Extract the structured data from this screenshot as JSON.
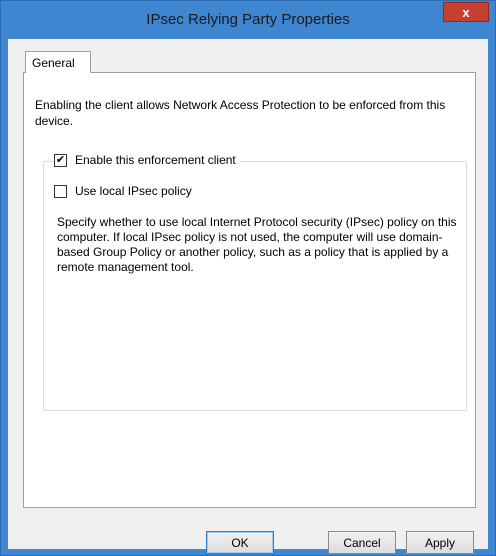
{
  "window": {
    "title": "IPsec Relying Party Properties",
    "close_label": "x"
  },
  "tabs": [
    {
      "label": "General",
      "selected": true
    }
  ],
  "general": {
    "intro_text": "Enabling the client allows Network Access Protection to be enforced from this device.",
    "enable_client": {
      "label": "Enable this enforcement client",
      "checked": true
    },
    "use_local_policy": {
      "label": "Use local IPsec policy",
      "checked": false
    },
    "description": "Specify whether to use local Internet Protocol security (IPsec) policy on this computer. If local IPsec policy is not used, the computer will use domain-based Group Policy or another policy, such as a policy that is applied by a remote management tool."
  },
  "buttons": {
    "ok": "OK",
    "cancel": "Cancel",
    "apply": "Apply"
  },
  "colors": {
    "titlebar": "#3f86d0",
    "close": "#c7402f",
    "dialog_bg": "#f0f0f0"
  }
}
